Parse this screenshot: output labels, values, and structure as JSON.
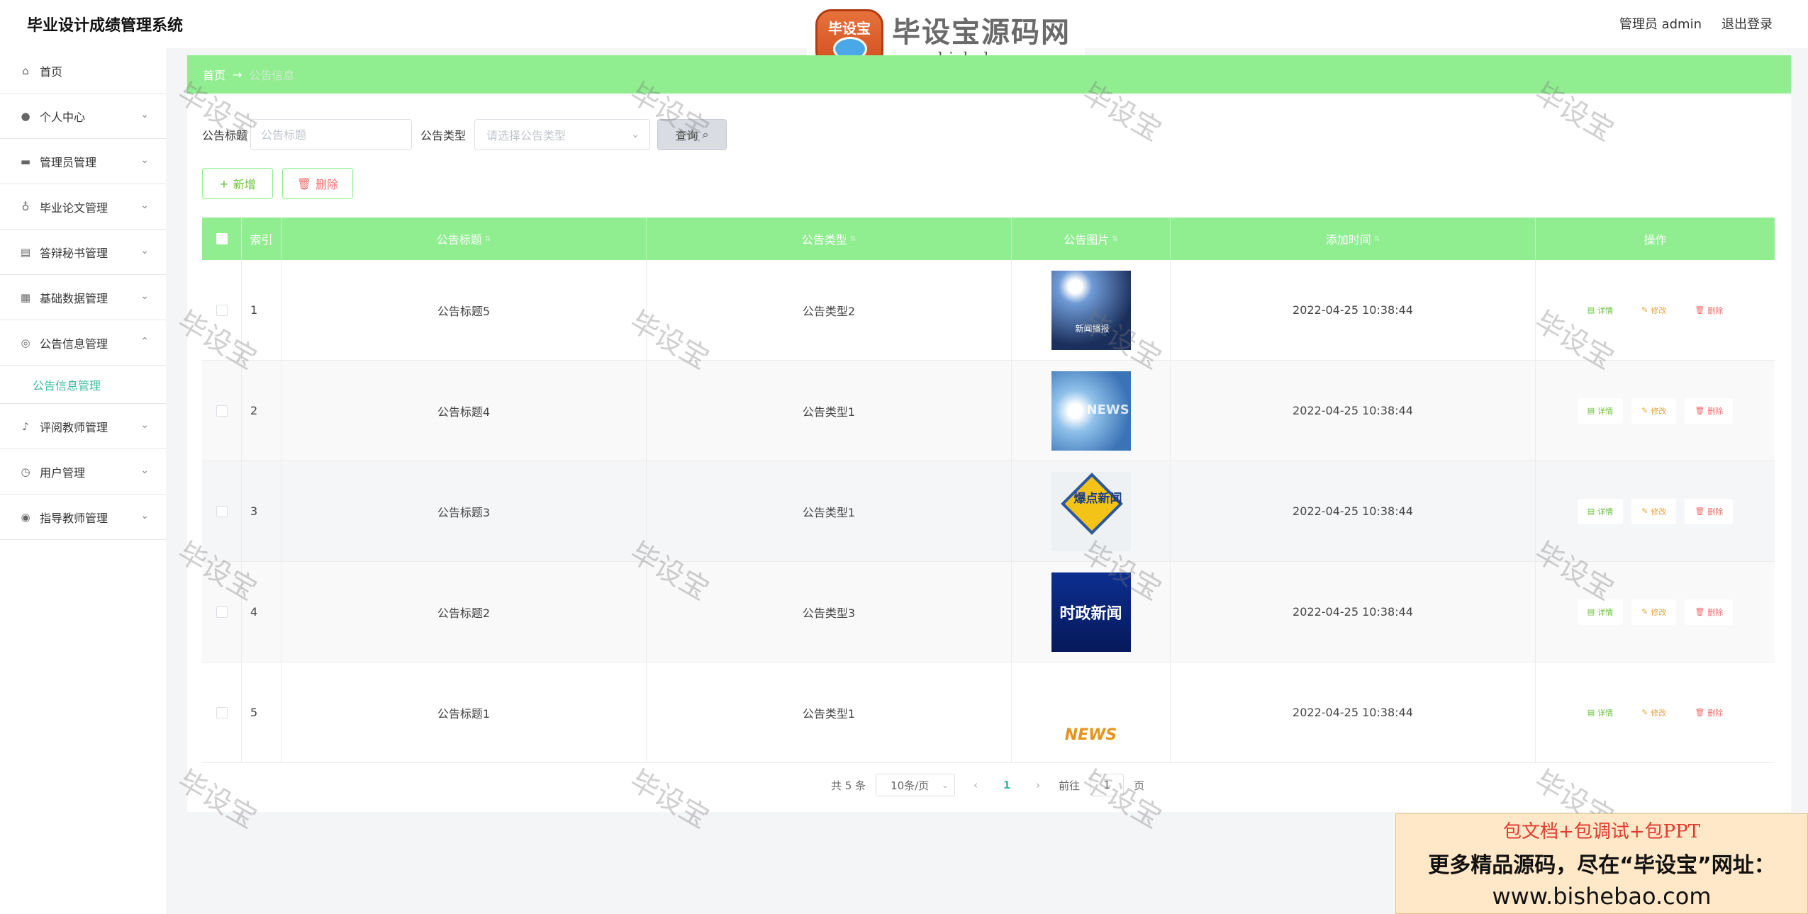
{
  "app": {
    "title": "毕业设计成绩管理系统"
  },
  "header": {
    "user_label": "管理员 admin",
    "logout_label": "退出登录"
  },
  "logo": {
    "badge": "毕设宝",
    "name": "毕设宝源码网",
    "url": "www.bishebao.com"
  },
  "sidebar": {
    "items": [
      {
        "label": "首页",
        "icon": "home-icon"
      },
      {
        "label": "个人中心",
        "icon": "user-icon"
      },
      {
        "label": "管理员管理",
        "icon": "briefcase-icon"
      },
      {
        "label": "毕业论文管理",
        "icon": "microphone-icon"
      },
      {
        "label": "答辩秘书管理",
        "icon": "clipboard-icon"
      },
      {
        "label": "基础数据管理",
        "icon": "grid-icon"
      },
      {
        "label": "公告信息管理",
        "icon": "bulb-icon"
      },
      {
        "label": "评阅教师管理",
        "icon": "bell-off-icon"
      },
      {
        "label": "用户管理",
        "icon": "clock-icon"
      },
      {
        "label": "指导教师管理",
        "icon": "compass-icon"
      }
    ],
    "submenu_active": "公告信息管理"
  },
  "breadcrumb": {
    "home": "首页",
    "arrow": "→",
    "current": "公告信息"
  },
  "search": {
    "title_label": "公告标题",
    "title_placeholder": "公告标题",
    "type_label": "公告类型",
    "type_placeholder": "请选择公告类型",
    "query_label": "查询"
  },
  "actions": {
    "add_label": "新增",
    "delete_label": "删除"
  },
  "table": {
    "headers": [
      "索引",
      "公告标题",
      "公告类型",
      "公告图片",
      "添加时间",
      "操作"
    ],
    "rows": [
      {
        "index": "1",
        "title": "公告标题5",
        "type": "公告类型2",
        "time": "2022-04-25 10:38:44"
      },
      {
        "index": "2",
        "title": "公告标题4",
        "type": "公告类型1",
        "time": "2022-04-25 10:38:44"
      },
      {
        "index": "3",
        "title": "公告标题3",
        "type": "公告类型1",
        "time": "2022-04-25 10:38:44"
      },
      {
        "index": "4",
        "title": "公告标题2",
        "type": "公告类型3",
        "time": "2022-04-25 10:38:44"
      },
      {
        "index": "5",
        "title": "公告标题1",
        "type": "公告类型1",
        "time": "2022-04-25 10:38:44"
      }
    ],
    "op_detail": "详情",
    "op_edit": "修改",
    "op_remove": "删除",
    "thumb_texts": {
      "t1": "新闻播报",
      "t2": "NEWS",
      "t3": "爆点新闻",
      "t4": "时政新闻",
      "t5": "NEWS"
    }
  },
  "pagination": {
    "total": "共 5 条",
    "page_size": "10条/页",
    "current_page": "1",
    "goto_prefix": "前往",
    "goto_value": "1",
    "goto_suffix": "页"
  },
  "watermark": {
    "text": "毕设宝"
  },
  "promo": {
    "line1": "包文档+包调试+包PPT",
    "line2": "更多精品源码，尽在“毕设宝”网址：",
    "line3": "www.bishebao.com"
  },
  "colors": {
    "accent": "#90ee90",
    "active": "#3fb9a2",
    "danger": "#f56c6c",
    "warning": "#e6a23c",
    "success": "#67c23a"
  }
}
